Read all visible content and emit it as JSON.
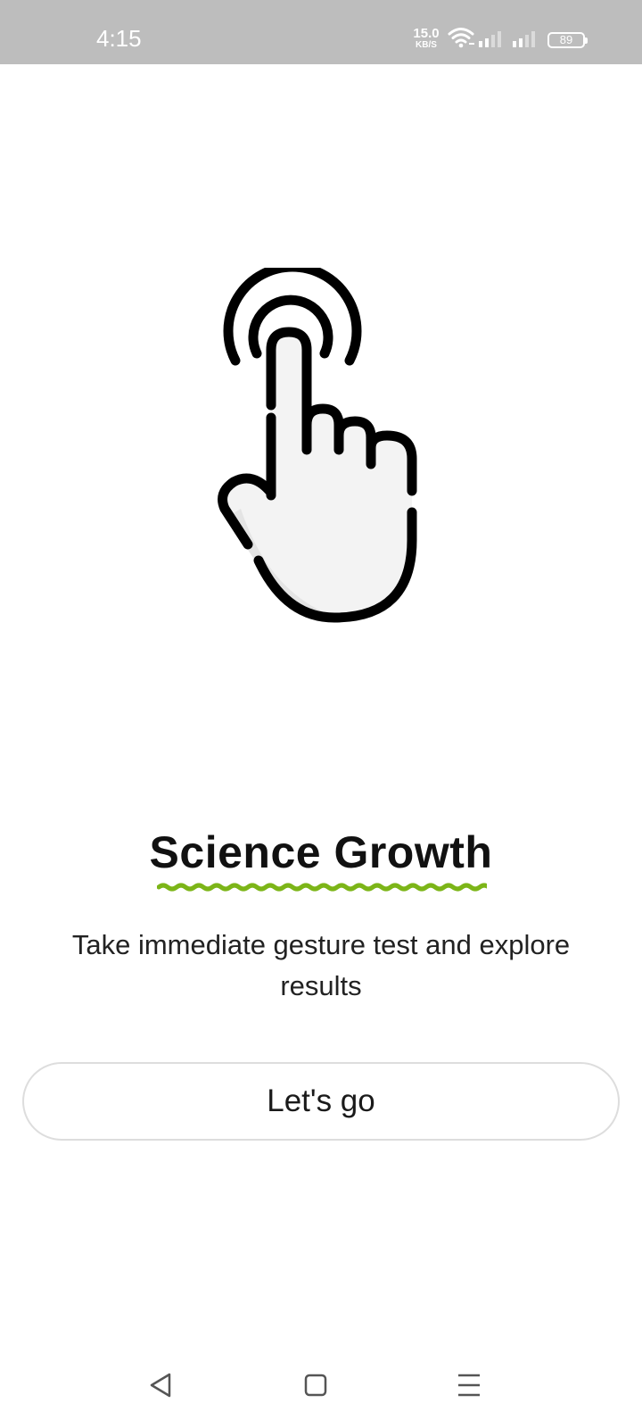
{
  "status_bar": {
    "time": "4:15",
    "net_speed_value": "15.0",
    "net_speed_unit": "KB/S",
    "battery_level": "89",
    "icons": [
      "wifi-icon",
      "signal-icon",
      "signal-icon",
      "battery-icon"
    ]
  },
  "illustration": {
    "icon": "tap-gesture-hand-icon"
  },
  "main": {
    "title": "Science Growth",
    "underline_color": "#7cb518",
    "subtitle": "Take immediate gesture test and explore results",
    "cta_label": "Let's go"
  },
  "nav_bar": {
    "icons": [
      "back-icon",
      "home-icon",
      "menu-icon"
    ]
  }
}
